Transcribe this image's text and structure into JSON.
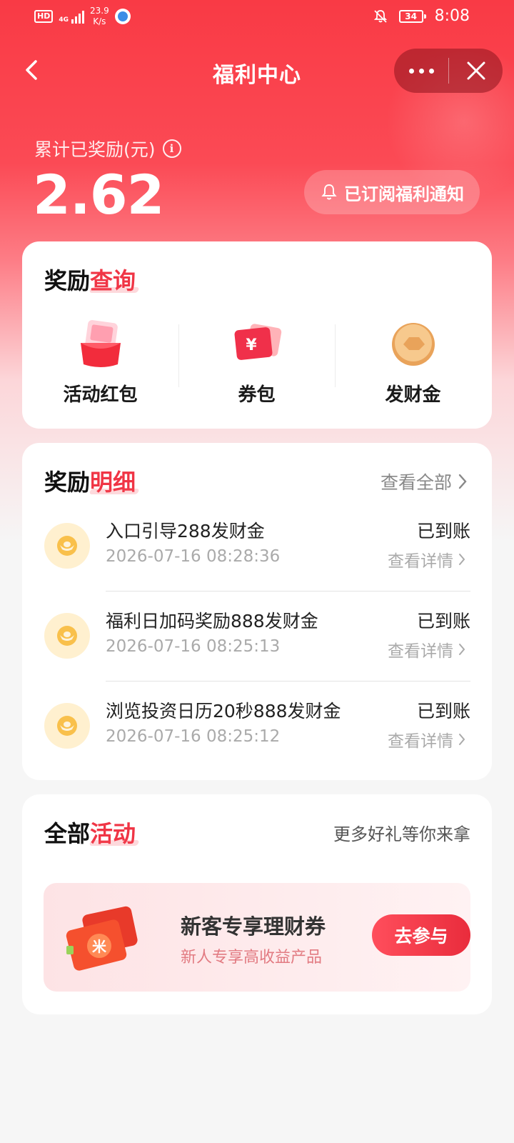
{
  "status_bar": {
    "hd": "HD",
    "network": "4G",
    "speed_value": "23.9",
    "speed_unit": "K/s",
    "battery": "34",
    "time": "8:08"
  },
  "nav": {
    "title": "福利中心"
  },
  "summary": {
    "label": "累计已奖励(元)",
    "info_glyph": "i",
    "value": "2.62",
    "subscribe_label": "已订阅福利通知"
  },
  "reward_query": {
    "title_plain": "奖励",
    "title_highlight": "查询",
    "items": [
      {
        "label": "活动红包",
        "icon": "red-envelope-icon"
      },
      {
        "label": "券包",
        "icon": "coupon-icon"
      },
      {
        "label": "发财金",
        "icon": "gold-coin-icon"
      }
    ]
  },
  "reward_detail": {
    "title_plain": "奖励",
    "title_highlight": "明细",
    "view_all": "查看全部",
    "rows": [
      {
        "title": "入口引导288发财金",
        "date": "2026-07-16 08:28:36",
        "status": "已到账",
        "detail": "查看详情"
      },
      {
        "title": "福利日加码奖励888发财金",
        "date": "2026-07-16 08:25:13",
        "status": "已到账",
        "detail": "查看详情"
      },
      {
        "title": "浏览投资日历20秒888发财金",
        "date": "2026-07-16 08:25:12",
        "status": "已到账",
        "detail": "查看详情"
      }
    ]
  },
  "activities": {
    "title_plain": "全部",
    "title_highlight": "活动",
    "more_text": "更多好礼等你来拿",
    "promo": {
      "title": "新客专享理财券",
      "subtitle": "新人专享高收益产品",
      "button": "去参与",
      "coupon_glyph": "米"
    }
  },
  "colors": {
    "brand_red": "#f93a45",
    "highlight_red": "#f03545",
    "coin_bg": "#fff0cf"
  }
}
